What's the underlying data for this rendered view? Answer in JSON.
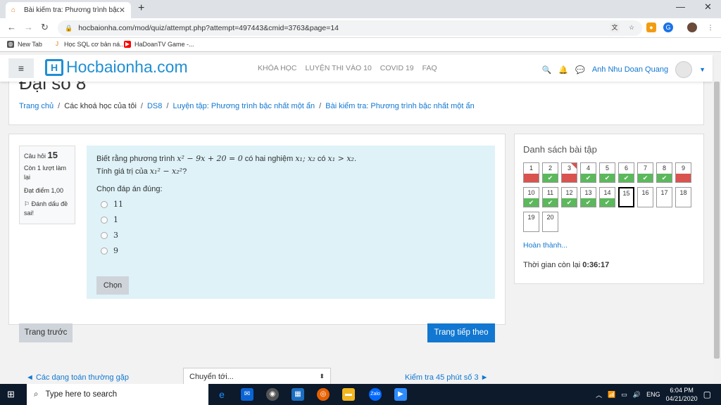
{
  "browser": {
    "tab_title": "Bài kiểm tra: Phương trình bậc nhấ",
    "tab_favicon": "moodle-icon",
    "new_tab": "+",
    "url": "hocbaionha.com/mod/quiz/attempt.php?attempt=497443&cmid=3763&page=14",
    "bookmarks": [
      {
        "label": "New Tab",
        "icon": "globe-icon",
        "color": "#555555"
      },
      {
        "label": "Học SQL cơ bản ná...",
        "icon": "java-icon",
        "color": "#e76f00"
      },
      {
        "label": "HaDoanTV Game -...",
        "icon": "youtube-icon",
        "color": "#ff0000"
      }
    ]
  },
  "site": {
    "logo_text": "Hocbaionha.com",
    "menu": [
      "KHÓA HỌC",
      "LUYỆN THI VÀO 10",
      "COVID 19",
      "FAQ"
    ],
    "user_name": "Anh Nhu Doan Quang"
  },
  "page": {
    "course_title": "Đại số 8",
    "breadcrumb": [
      "Trang chủ",
      "Các khoá học của tôi",
      "DS8",
      "Luyện tập: Phương trình bậc nhất một ẩn",
      "Bài kiểm tra: Phương trình bậc nhất một ẩn"
    ]
  },
  "question": {
    "label": "Câu hỏi",
    "number": "15",
    "attempts": "Còn 1 lượt làm lại",
    "points": "Đạt điểm 1,00",
    "flag": "Đánh dấu đề sai!",
    "text_a": "Biết rằng phương trình ",
    "math_a": "x² − 9x + 20 = 0",
    "text_b": " có hai nghiệm ",
    "math_b": "x₁; x₂",
    "text_c": " có ",
    "math_c": "x₁ > x₂",
    "text_d": ".",
    "text_e": "Tính giá trị của ",
    "math_e": "x₁² − x₂²",
    "text_f": "?",
    "prompt": "Chọn đáp án đúng:",
    "options": [
      "11",
      "1",
      "3",
      "9"
    ],
    "submit": "Chọn"
  },
  "navigator": {
    "title": "Danh sách bài tập",
    "buttons": [
      {
        "n": "1",
        "status": "bad"
      },
      {
        "n": "2",
        "status": "ok"
      },
      {
        "n": "3",
        "status": "bad"
      },
      {
        "n": "4",
        "status": "ok"
      },
      {
        "n": "5",
        "status": "ok"
      },
      {
        "n": "6",
        "status": "ok"
      },
      {
        "n": "7",
        "status": "ok"
      },
      {
        "n": "8",
        "status": "ok"
      },
      {
        "n": "9",
        "status": "bad"
      },
      {
        "n": "10",
        "status": "ok"
      },
      {
        "n": "11",
        "status": "ok"
      },
      {
        "n": "12",
        "status": "ok"
      },
      {
        "n": "13",
        "status": "ok"
      },
      {
        "n": "14",
        "status": "ok"
      },
      {
        "n": "15",
        "status": "current"
      },
      {
        "n": "16",
        "status": "none"
      },
      {
        "n": "17",
        "status": "none"
      },
      {
        "n": "18",
        "status": "none"
      },
      {
        "n": "19",
        "status": "none"
      },
      {
        "n": "20",
        "status": "none"
      }
    ],
    "finish": "Hoàn thành...",
    "time_label": "Thời gian còn lại",
    "time_value": "0:36:17"
  },
  "buttons": {
    "prev": "Trang trước",
    "next": "Trang tiếp theo",
    "prev_activity": "◄ Các dạng toán thường gặp",
    "jump": "Chuyển tới...",
    "next_activity": "Kiểm tra 45 phút số 3 ►"
  },
  "taskbar": {
    "search_placeholder": "Type here to search",
    "lang": "ENG",
    "time": "6:04 PM",
    "date": "04/21/2020"
  },
  "colors": {
    "accent": "#1177d1",
    "ok": "#5cb85c",
    "bad": "#d9534f",
    "question_bg": "#def2f8"
  }
}
